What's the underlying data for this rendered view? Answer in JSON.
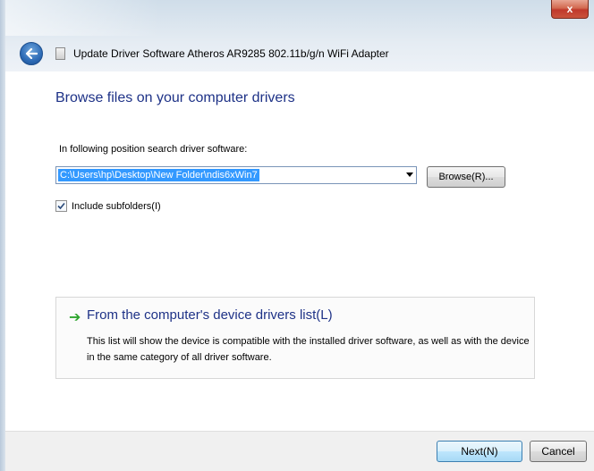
{
  "window": {
    "close_label": "x",
    "title": "Update Driver Software Atheros AR9285 802.11b/g/n WiFi Adapter"
  },
  "icons": {
    "back": "back-arrow-icon",
    "device": "device-icon",
    "close": "close-icon",
    "option_arrow": "green-arrow-icon",
    "checkmark": "checkmark-icon"
  },
  "main": {
    "heading": "Browse files on your computer drivers",
    "search_label": "In following position search driver software:",
    "path_value": "C:\\Users\\hp\\Desktop\\New Folder\\ndis6xWin7",
    "browse_label": "Browse(R)...",
    "include_subfolders": {
      "label": "Include subfolders(I)",
      "checked": true
    },
    "option": {
      "title": "From the computer's device drivers list(L)",
      "description": "This list will show the device is compatible with the installed driver software, as well as with the device in the same category of all driver software."
    }
  },
  "footer": {
    "next_label": "Next(N)",
    "cancel_label": "Cancel"
  },
  "colors": {
    "heading": "#1e3287",
    "selection": "#3399ff",
    "arrow_green": "#2ea52e",
    "close_red": "#c0392b"
  }
}
